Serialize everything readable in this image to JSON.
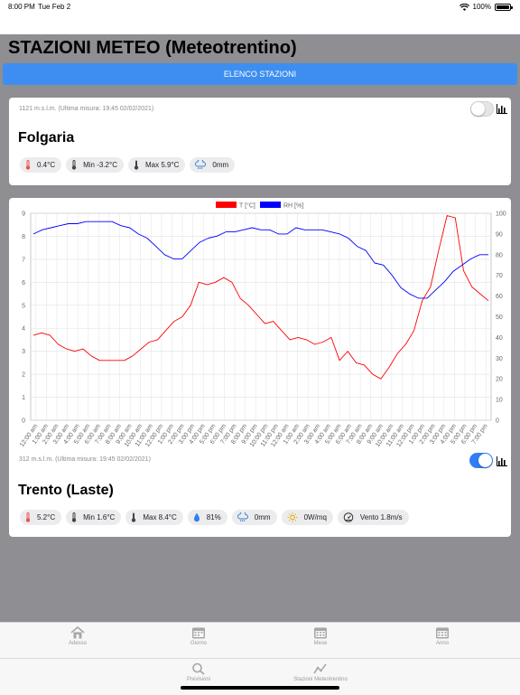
{
  "status_bar": {
    "time": "8:00 PM",
    "date": "Tue Feb 2",
    "battery": "100%"
  },
  "header": {
    "title": "STAZIONI METEO (Meteotrentino)"
  },
  "elenco_button": {
    "label": "ELENCO STAZIONI"
  },
  "colors": {
    "accent": "#3d8ef0",
    "toggle_on": "#2f7ef6",
    "temperature": "#ff0000",
    "humidity": "#0000ff"
  },
  "stations": [
    {
      "meta": "1121 m.s.l.m. (Ultima misura: 19:45 02/02/2021)",
      "name": "Folgaria",
      "chart_toggle_on": false,
      "chips": [
        {
          "icon": "thermometer-red-icon",
          "text": "0.4°C"
        },
        {
          "icon": "thermometer-low-icon",
          "text": "Min -3.2°C"
        },
        {
          "icon": "thermometer-high-icon",
          "text": "Max 5.9°C"
        },
        {
          "icon": "rain-cloud-icon",
          "text": "0mm"
        }
      ]
    },
    {
      "meta": "312 m.s.l.m. (Ultima misura: 19:45 02/02/2021)",
      "name": "Trento (Laste)",
      "chart_toggle_on": true,
      "chips": [
        {
          "icon": "thermometer-red-icon",
          "text": "5.2°C"
        },
        {
          "icon": "thermometer-low-icon",
          "text": "Min 1.6°C"
        },
        {
          "icon": "thermometer-high-icon",
          "text": "Max 8.4°C"
        },
        {
          "icon": "humidity-drop-icon",
          "text": "81%"
        },
        {
          "icon": "rain-cloud-icon",
          "text": "0mm"
        },
        {
          "icon": "sun-icon",
          "text": "0W/mq"
        },
        {
          "icon": "wind-gauge-icon",
          "text": "Vento 1.8m/s"
        }
      ]
    }
  ],
  "chart_data": {
    "type": "line",
    "legend": [
      "T [°C]",
      "RH [%]"
    ],
    "legend_position": "top-center",
    "grid": true,
    "x_labels": [
      "12:00 am",
      "1:00 am",
      "2:00 am",
      "3:00 am",
      "4:00 am",
      "5:00 am",
      "6:00 am",
      "7:00 am",
      "8:00 am",
      "9:00 am",
      "10:00 am",
      "11:00 am",
      "12:00 pm",
      "1:00 pm",
      "2:00 pm",
      "3:00 pm",
      "4:00 pm",
      "5:00 pm",
      "6:00 pm",
      "7:00 pm",
      "8:00 pm",
      "9:00 pm",
      "10:00 pm",
      "11:00 pm",
      "12:00 am",
      "1:00 am",
      "2:00 am",
      "3:00 am",
      "4:00 am",
      "5:00 am",
      "6:00 am",
      "7:00 am",
      "8:00 am",
      "9:00 am",
      "10:00 am",
      "11:00 am",
      "12:00 pm",
      "1:00 pm",
      "2:00 pm",
      "3:00 pm",
      "4:00 pm",
      "5:00 pm",
      "6:00 pm",
      "7:00 pm"
    ],
    "y_left": {
      "label": "T [°C]",
      "range": [
        0,
        9
      ],
      "ticks": [
        0,
        1,
        2,
        3,
        4,
        5,
        6,
        7,
        8,
        9
      ]
    },
    "y_right": {
      "label": "RH [%]",
      "range": [
        0,
        100
      ],
      "ticks": [
        0,
        10,
        20,
        30,
        40,
        50,
        60,
        70,
        80,
        90,
        100
      ]
    },
    "series": [
      {
        "name": "T [°C]",
        "axis": "left",
        "color": "#ff0000",
        "values": [
          3.7,
          3.8,
          3.7,
          3.3,
          3.1,
          3.0,
          3.1,
          2.8,
          2.6,
          2.6,
          2.6,
          2.6,
          2.8,
          3.1,
          3.4,
          3.5,
          3.9,
          4.3,
          4.5,
          5.0,
          6.0,
          5.9,
          6.0,
          6.2,
          6.0,
          5.3,
          5.0,
          4.6,
          4.2,
          4.3,
          3.9,
          3.5,
          3.6,
          3.5,
          3.3,
          3.4,
          3.6,
          2.6,
          3.0,
          2.5,
          2.4,
          2.0,
          1.8,
          2.3,
          2.9,
          3.3,
          3.9,
          5.2,
          5.8,
          7.4,
          8.9,
          8.8,
          6.5,
          5.8,
          5.5,
          5.2
        ]
      },
      {
        "name": "RH [%]",
        "axis": "right",
        "color": "#0000ff",
        "values": [
          90,
          92,
          93,
          94,
          95,
          95,
          96,
          96,
          96,
          96,
          94,
          93,
          90,
          88,
          84,
          80,
          78,
          78,
          82,
          86,
          88,
          89,
          91,
          91,
          92,
          93,
          92,
          92,
          90,
          90,
          93,
          92,
          92,
          92,
          91,
          90,
          88,
          84,
          82,
          76,
          75,
          70,
          64,
          61,
          59,
          59,
          63,
          67,
          72,
          75,
          78,
          80,
          80
        ]
      }
    ]
  },
  "tabbar": {
    "tabs": [
      {
        "label": "Adesso",
        "icon": "home-icon"
      },
      {
        "label": "Giorno",
        "icon": "calendar-day-icon"
      },
      {
        "label": "Mese",
        "icon": "calendar-month-icon"
      },
      {
        "label": "Anno",
        "icon": "calendar-year-icon"
      }
    ],
    "tabs_bottom": [
      {
        "label": "Previsioni",
        "icon": "magnifier-icon"
      },
      {
        "label": "Stazioni Meteotrentino",
        "icon": "trend-icon"
      }
    ]
  }
}
